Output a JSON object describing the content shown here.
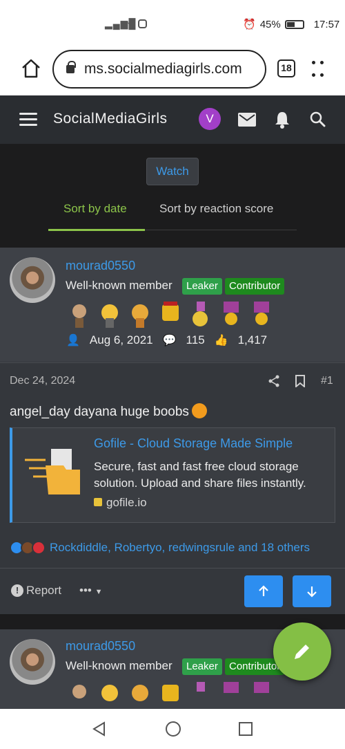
{
  "status_bar": {
    "signal": "▂▄▆█",
    "battery": "45%",
    "time": "17:57"
  },
  "browser": {
    "url": "ms.socialmediagirls.com",
    "tab_count": "18"
  },
  "site": {
    "name": "SocialMediaGirls",
    "avatar_letter": "V"
  },
  "controls": {
    "watch": "Watch",
    "sort_date": "Sort by date",
    "sort_reaction": "Sort by reaction score"
  },
  "post": {
    "username": "mourad0550",
    "user_title": "Well-known member",
    "badges": [
      "Leaker",
      "Contributor"
    ],
    "joined": "Aug 6, 2021",
    "messages": "115",
    "reactions_score": "1,417",
    "date": "Dec 24, 2024",
    "number": "#1",
    "text": "angel_day dayana huge boobs",
    "embed": {
      "title": "Gofile - Cloud Storage Made Simple",
      "description": "Secure, fast and fast free cloud storage solution. Upload and share files instantly.",
      "site": "gofile.io"
    },
    "reaction_users": "Rockdiddle, Robertyo, redwingsrule and 18 others",
    "report": "Report",
    "more": "•••"
  },
  "colors": {
    "accent_blue": "#3d9ae8",
    "accent_green": "#8cc44a",
    "leaker_badge": "#2fa04a",
    "contributor_badge": "#1e8a1e",
    "fab": "#84bf45"
  }
}
